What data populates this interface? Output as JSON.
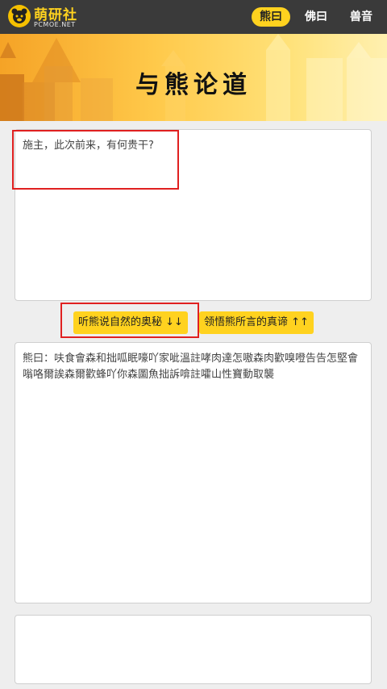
{
  "app": {
    "logo_name": "萌研社",
    "logo_subtitle": "PCMOE.NET",
    "nav": [
      {
        "label": "熊曰",
        "active": true
      },
      {
        "label": "佛曰",
        "active": false
      },
      {
        "label": "兽音",
        "active": false
      }
    ]
  },
  "banner": {
    "title": "与熊论道"
  },
  "input": {
    "value": "施主，此次前来，有何贵干?"
  },
  "buttons": {
    "decode_label": "听熊说自然的奥秘 ↓↓",
    "encode_label": "领悟熊所言的真谛 ↑↑"
  },
  "output": {
    "value": "熊曰：呋食會森和拙呱眠嚎吖家呲溫註哮肉達怎嗷森肉歡嗅噔告告怎堅會嗡咯爾誒森爾歡蜂吖你森圖魚拙訴啽註嚯山性寶動取襲"
  },
  "colors": {
    "accent": "#ffd21f",
    "topbar": "#3a3a3a",
    "highlight": "#e02020"
  }
}
